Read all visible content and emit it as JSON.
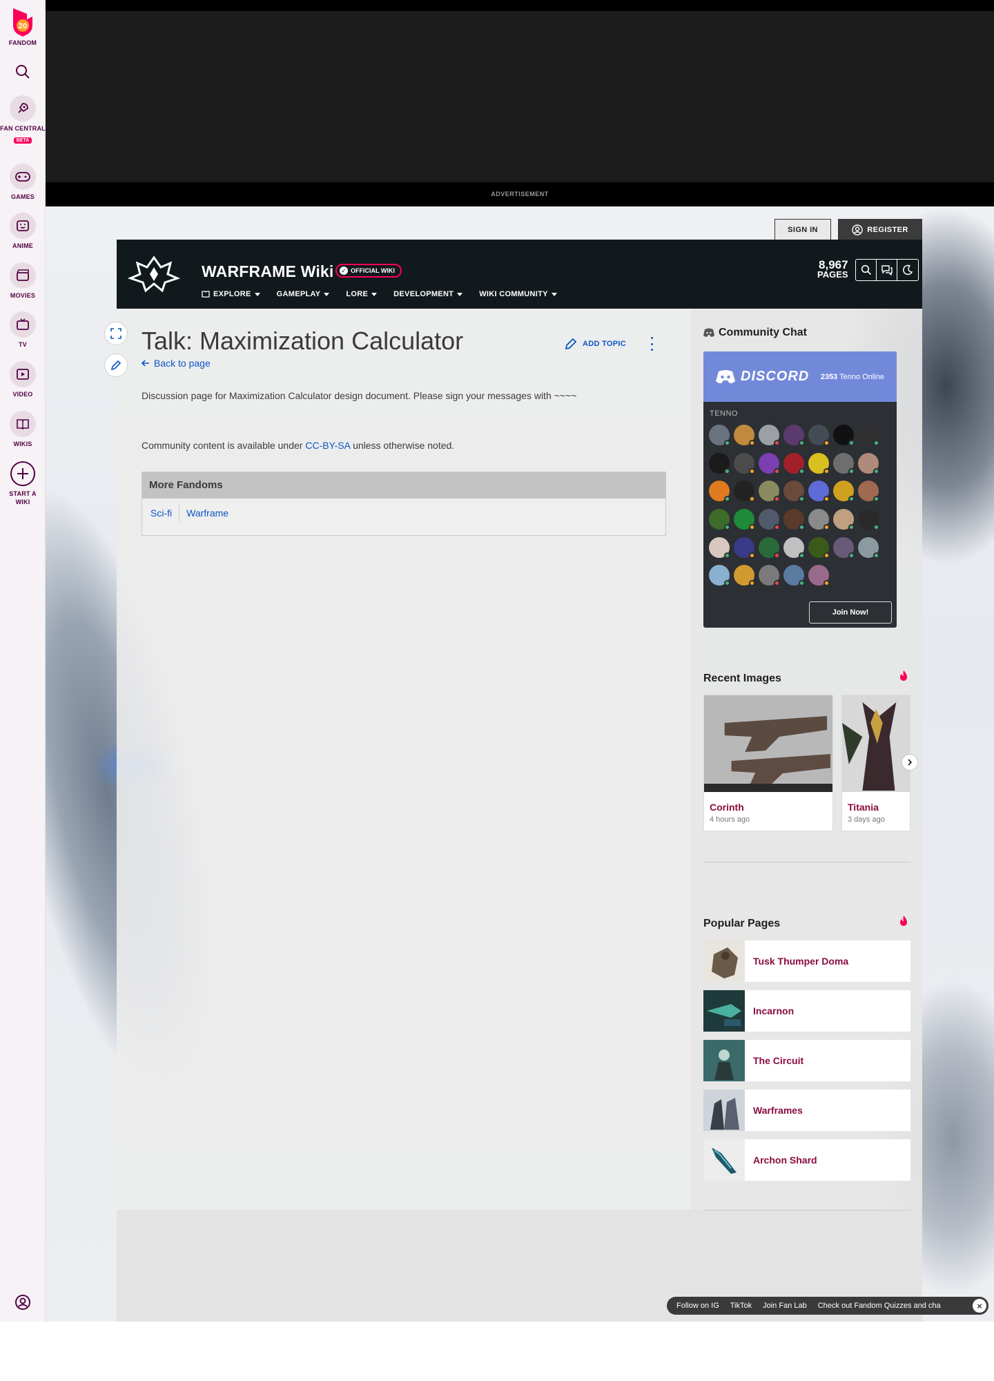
{
  "global_nav": {
    "brand_label": "FANDOM",
    "brand_badge": "20",
    "items": [
      {
        "label": "FAN CENTRAL",
        "badge": "BETA",
        "icon": "rocket-icon"
      },
      {
        "label": "GAMES",
        "icon": "gamepad-icon"
      },
      {
        "label": "ANIME",
        "icon": "anime-face-icon"
      },
      {
        "label": "MOVIES",
        "icon": "clapper-icon"
      },
      {
        "label": "TV",
        "icon": "tv-icon"
      },
      {
        "label": "VIDEO",
        "icon": "play-icon"
      },
      {
        "label": "WIKIS",
        "icon": "book-icon"
      },
      {
        "label": "START A WIKI",
        "icon": "plus-circle-icon"
      }
    ]
  },
  "ad": {
    "label": "ADVERTISEMENT"
  },
  "account": {
    "sign_in": "SIGN IN",
    "register": "REGISTER"
  },
  "wiki": {
    "title": "WARFRAME Wiki",
    "official_badge": "OFFICIAL WIKI",
    "page_count": "8,967",
    "page_count_label": "PAGES",
    "nav": [
      "EXPLORE",
      "GAMEPLAY",
      "LORE",
      "DEVELOPMENT",
      "WIKI COMMUNITY"
    ]
  },
  "page": {
    "title": "Talk: Maximization Calculator",
    "back_link": "Back to page",
    "add_topic": "ADD TOPIC",
    "description": "Discussion page for Maximization Calculator design document. Please sign your messages with ~~~~",
    "license_prefix": "Community content is available under ",
    "license_link": "CC-BY-SA",
    "license_suffix": " unless otherwise noted."
  },
  "more_fandoms": {
    "heading": "More Fandoms",
    "links": [
      "Sci-fi",
      "Warframe"
    ]
  },
  "community_chat": {
    "heading": "Community Chat",
    "brand": "DISCORD",
    "online_count": "2353",
    "online_label": "Tenno Online",
    "group": "TENNO",
    "join": "Join Now!",
    "avatar_colors": [
      "#6b7280",
      "#c08a3e",
      "#9aa0a6",
      "#5b3a6e",
      "#444b55",
      "#111111",
      "#2f2f2f",
      "#1a1a1a",
      "#4b4b4b",
      "#7a3fb0",
      "#a3202a",
      "#d9c020",
      "#6e6e6e",
      "#b08a7a",
      "#e07a20",
      "#222222",
      "#8a8a60",
      "#6a4a3a",
      "#5f6bd8",
      "#d0a020",
      "#a06a50",
      "#3d6b2a",
      "#1e8a3a",
      "#505a6a",
      "#5a3a2a",
      "#8a8a8a",
      "#c0a080",
      "#2a2a2a",
      "#d8c8c0",
      "#3a3a8a",
      "#2a6a3a",
      "#c0c0c0",
      "#3a5a1a",
      "#6a5a7a",
      "#8a9aa0",
      "#8ab0d0",
      "#d09a30",
      "#7a7a7a",
      "#5a7aa0",
      "#9a6a8a"
    ],
    "status_colors": [
      "#43b581",
      "#faa61a",
      "#f04747",
      "#43b581",
      "#faa61a",
      "#43b581",
      "#43b581"
    ]
  },
  "recent_images": {
    "heading": "Recent Images",
    "items": [
      {
        "title": "Corinth",
        "time": "4 hours ago"
      },
      {
        "title": "Titania",
        "time": "3 days ago"
      }
    ]
  },
  "popular_pages": {
    "heading": "Popular Pages",
    "items": [
      "Tusk Thumper Doma",
      "Incarnon",
      "The Circuit",
      "Warframes",
      "Archon Shard"
    ]
  },
  "social_bar": {
    "items": [
      "Follow on IG",
      "TikTok",
      "Join Fan Lab",
      "Check out Fandom Quizzes and cha"
    ]
  },
  "colors": {
    "fandom_pink": "#fa005a",
    "link_blue": "#0b55c6",
    "wiki_header": "#12191d",
    "discord": "#7289da"
  }
}
